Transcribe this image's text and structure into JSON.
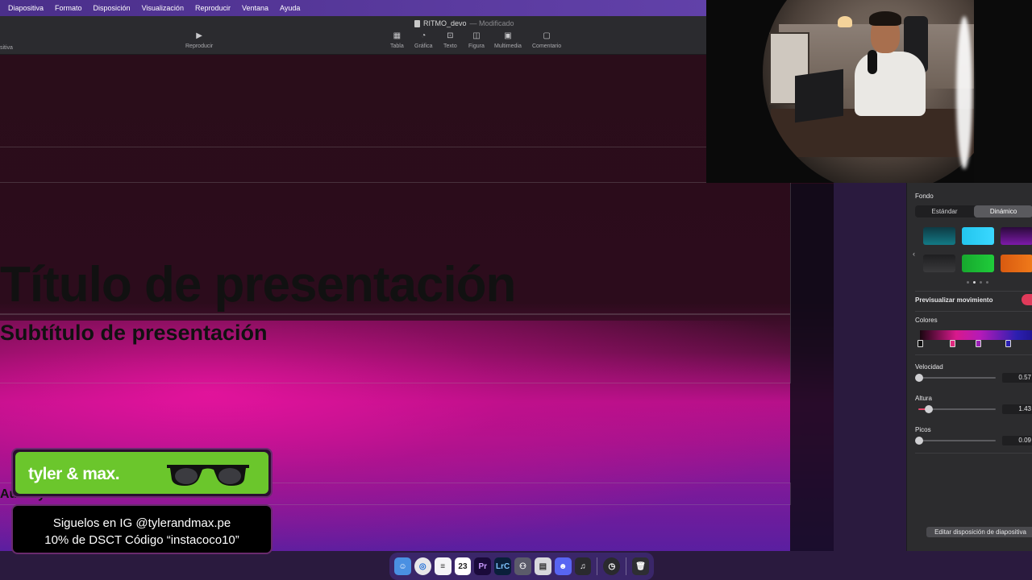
{
  "menubar": {
    "items": [
      "Diapositiva",
      "Formato",
      "Disposición",
      "Visualización",
      "Reproducir",
      "Ventana",
      "Ayuda"
    ]
  },
  "toolbar": {
    "doc_name": "RITMO_devo",
    "doc_status": "— Modificado",
    "left_label": "sitiva",
    "play_label": "Reproducir",
    "buttons": [
      {
        "label": "Tabla",
        "icon": "table-icon"
      },
      {
        "label": "Gráfica",
        "icon": "chart-icon"
      },
      {
        "label": "Texto",
        "icon": "text-icon"
      },
      {
        "label": "Figura",
        "icon": "shape-icon"
      },
      {
        "label": "Multimedia",
        "icon": "media-icon"
      },
      {
        "label": "Comentario",
        "icon": "comment-icon"
      }
    ]
  },
  "slide": {
    "title": "Título de presentación",
    "subtitle": "Subtítulo de presentación",
    "author": "Autor y fecha"
  },
  "inspector": {
    "section_label": "Fondo",
    "segments": [
      "Estándar",
      "Dinámico"
    ],
    "active_segment": "Dinámico",
    "preview_motion_label": "Previsualizar movimiento",
    "preview_motion_on": true,
    "colors_label": "Colores",
    "velocidad": {
      "label": "Velocidad",
      "value": "0.57"
    },
    "altura": {
      "label": "Altura",
      "value": "1.43"
    },
    "picos": {
      "label": "Picos",
      "value": "0.09"
    },
    "edit_layout_label": "Editar disposición de diapositiva",
    "swatch_colors": [
      "#137a86",
      "#23c5ee",
      "#7d1aa8",
      "#3a3a3c",
      "#1fcc3a",
      "#f07a1a"
    ]
  },
  "promo": {
    "brand": "tyler & max.",
    "line1": "Siguelos en IG @tylerandmax.pe",
    "line2": "10% de DSCT Código “instacoco10”"
  },
  "dock": {
    "calendar_day": "23",
    "apps": [
      "finder",
      "safari",
      "notes",
      "calendar",
      "premiere",
      "lightroom",
      "mixer",
      "storage",
      "discord",
      "music",
      "timemachine",
      "trash"
    ]
  }
}
